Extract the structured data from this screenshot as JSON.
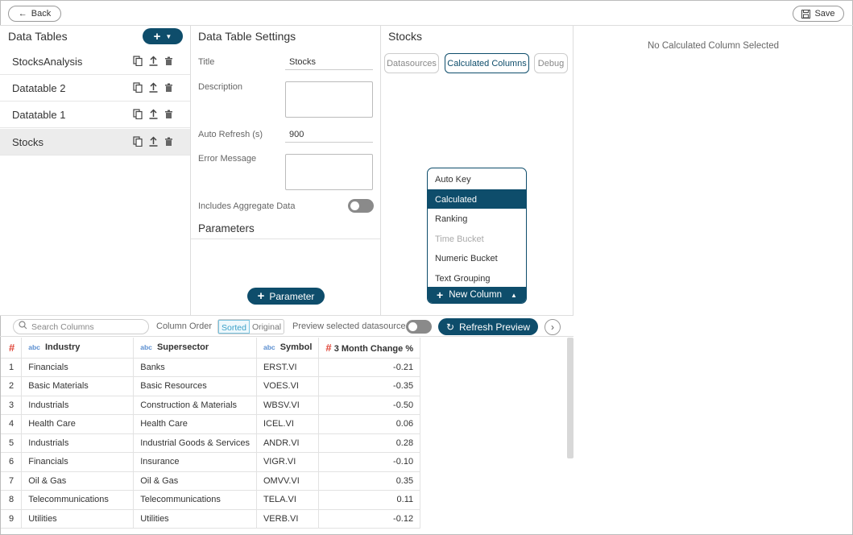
{
  "topbar": {
    "back_label": "Back",
    "save_label": "Save"
  },
  "data_tables": {
    "title": "Data Tables",
    "items": [
      {
        "label": "StocksAnalysis"
      },
      {
        "label": "Datatable 2"
      },
      {
        "label": "Datatable 1"
      },
      {
        "label": "Stocks"
      }
    ]
  },
  "settings": {
    "title": "Data Table Settings",
    "title_label": "Title",
    "title_value": "Stocks",
    "description_label": "Description",
    "auto_refresh_label": "Auto Refresh (s)",
    "auto_refresh_value": "900",
    "error_label": "Error Message",
    "aggregate_label": "Includes Aggregate Data",
    "parameters_title": "Parameters",
    "parameter_button": "Parameter"
  },
  "stocks_panel": {
    "title": "Stocks",
    "tabs": [
      "Datasources",
      "Calculated Columns",
      "Debug"
    ],
    "menu": [
      {
        "label": "Auto Key",
        "state": "normal"
      },
      {
        "label": "Calculated",
        "state": "selected"
      },
      {
        "label": "Ranking",
        "state": "normal"
      },
      {
        "label": "Time Bucket",
        "state": "disabled"
      },
      {
        "label": "Numeric Bucket",
        "state": "normal"
      },
      {
        "label": "Text Grouping",
        "state": "normal"
      }
    ],
    "new_column_label": "New Column"
  },
  "detail": {
    "empty_message": "No Calculated Column Selected"
  },
  "preview_toolbar": {
    "search_placeholder": "Search Columns",
    "column_order_label": "Column Order",
    "sorted_label": "Sorted",
    "original_label": "Original",
    "preview_label": "Preview selected datasource",
    "refresh_label": "Refresh Preview"
  },
  "preview_table": {
    "index_header": "#",
    "columns": [
      {
        "type": "abc",
        "label": "Industry"
      },
      {
        "type": "abc",
        "label": "Supersector"
      },
      {
        "type": "abc",
        "label": "Symbol"
      },
      {
        "type": "#",
        "label": "3 Month Change %"
      }
    ],
    "rows": [
      [
        "1",
        "Financials",
        "Banks",
        "ERST.VI",
        "-0.21"
      ],
      [
        "2",
        "Basic Materials",
        "Basic Resources",
        "VOES.VI",
        "-0.35"
      ],
      [
        "3",
        "Industrials",
        "Construction & Materials",
        "WBSV.VI",
        "-0.50"
      ],
      [
        "4",
        "Health Care",
        "Health Care",
        "ICEL.VI",
        "0.06"
      ],
      [
        "5",
        "Industrials",
        "Industrial Goods & Services",
        "ANDR.VI",
        "0.28"
      ],
      [
        "6",
        "Financials",
        "Insurance",
        "VIGR.VI",
        "-0.10"
      ],
      [
        "7",
        "Oil & Gas",
        "Oil & Gas",
        "OMVV.VI",
        "0.35"
      ],
      [
        "8",
        "Telecommunications",
        "Telecommunications",
        "TELA.VI",
        "0.11"
      ],
      [
        "9",
        "Utilities",
        "Utilities",
        "VERB.VI",
        "-0.12"
      ]
    ]
  }
}
